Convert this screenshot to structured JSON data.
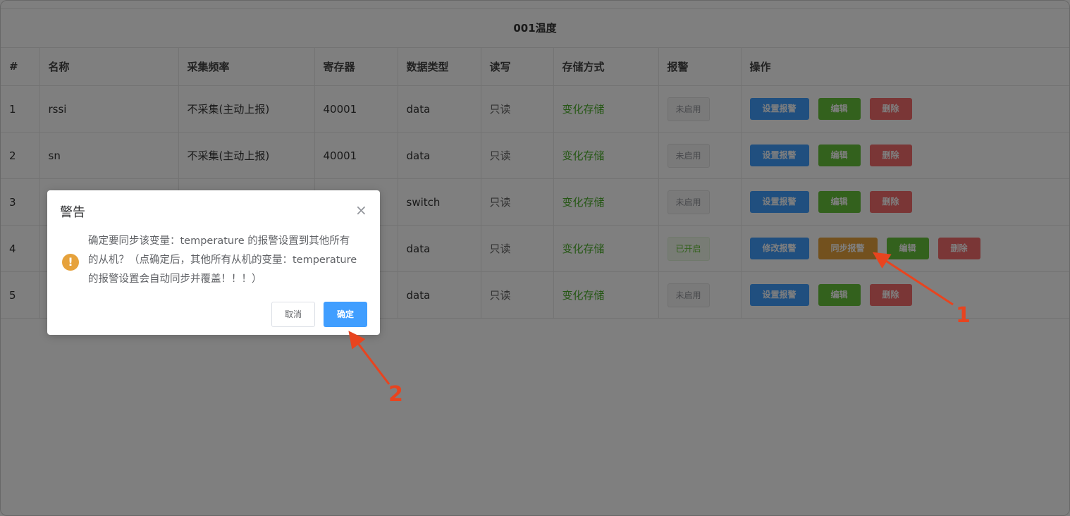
{
  "table": {
    "title": "001温度",
    "headers": [
      "#",
      "名称",
      "采集频率",
      "寄存器",
      "数据类型",
      "读写",
      "存储方式",
      "报警",
      "操作"
    ],
    "rows": [
      {
        "index": "1",
        "name": "rssi",
        "frequency": "不采集(主动上报)",
        "register": "40001",
        "data_type": "data",
        "rw": "只读",
        "storage": "变化存储",
        "alarm": "未启用"
      },
      {
        "index": "2",
        "name": "sn",
        "frequency": "不采集(主动上报)",
        "register": "40001",
        "data_type": "data",
        "rw": "只读",
        "storage": "变化存储",
        "alarm": "未启用"
      },
      {
        "index": "3",
        "name": "",
        "frequency": "",
        "register": "",
        "data_type": "switch",
        "rw": "只读",
        "storage": "变化存储",
        "alarm": "未启用"
      },
      {
        "index": "4",
        "name": "",
        "frequency": "",
        "register": "",
        "data_type": "data",
        "rw": "只读",
        "storage": "变化存储",
        "alarm": "已开启"
      },
      {
        "index": "5",
        "name": "",
        "frequency": "",
        "register": "",
        "data_type": "data",
        "rw": "只读",
        "storage": "变化存储",
        "alarm": "未启用"
      }
    ],
    "actions": {
      "set_alarm": "设置报警",
      "modify_alarm": "修改报警",
      "sync_alarm": "同步报警",
      "edit": "编辑",
      "delete": "删除"
    }
  },
  "dialog": {
    "title": "警告",
    "close": "×",
    "icon": "warning-icon",
    "message": "确定要同步该变量：temperature 的报警设置到其他所有的从机？（点确定后，其他所有从机的变量：temperature 的报警设置会自动同步并覆盖！！！）",
    "cancel_label": "取消",
    "confirm_label": "确定"
  },
  "annotations": {
    "marker_1": "1",
    "marker_2": "2",
    "color": "#e8441f"
  }
}
